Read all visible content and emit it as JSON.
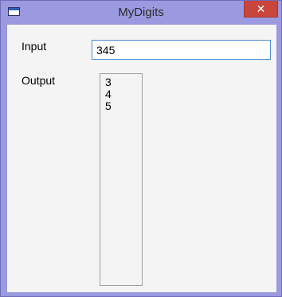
{
  "window": {
    "title": "MyDigits",
    "close_glyph": "✕",
    "icon": "window-app-icon"
  },
  "form": {
    "input_label": "Input",
    "input_value": "345",
    "output_label": "Output",
    "output_lines": [
      "3",
      "4",
      "5"
    ]
  },
  "colors": {
    "frame": "#9b9ae0",
    "close_button": "#c9463d",
    "client_bg": "#f4f4f4",
    "input_border": "#4e8cd4"
  }
}
